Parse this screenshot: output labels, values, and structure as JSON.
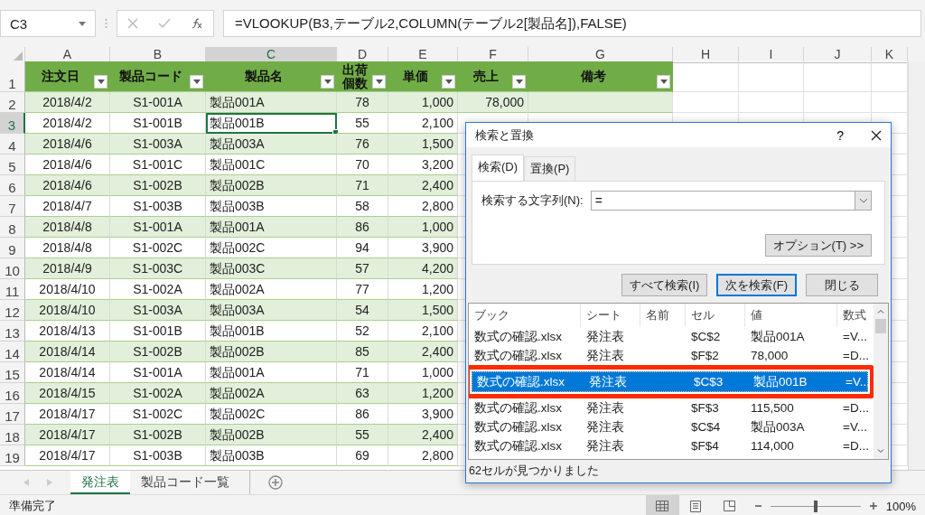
{
  "name_box": "C3",
  "formula": "=VLOOKUP(B3,テーブル2,COLUMN(テーブル2[製品名]),FALSE)",
  "columns": [
    {
      "label": "A",
      "selected": false
    },
    {
      "label": "B",
      "selected": false
    },
    {
      "label": "C",
      "selected": true
    },
    {
      "label": "D",
      "selected": false
    },
    {
      "label": "E",
      "selected": false
    },
    {
      "label": "F",
      "selected": false
    },
    {
      "label": "G",
      "selected": false
    },
    {
      "label": "H",
      "selected": false
    },
    {
      "label": "I",
      "selected": false
    },
    {
      "label": "J",
      "selected": false
    },
    {
      "label": "K",
      "selected": false
    }
  ],
  "header_row": {
    "number": "1",
    "cells": [
      "注文日",
      "製品コード",
      "製品名",
      "出荷個数",
      "単価",
      "売上",
      "備考"
    ]
  },
  "rows": [
    {
      "number": "2",
      "selected": false,
      "cells": [
        "2018/4/2",
        "S1-001A",
        "製品001A",
        "78",
        "1,000",
        "78,000"
      ]
    },
    {
      "number": "3",
      "selected": true,
      "cells": [
        "2018/4/2",
        "S1-001B",
        "製品001B",
        "55",
        "2,100"
      ]
    },
    {
      "number": "4",
      "selected": false,
      "cells": [
        "2018/4/6",
        "S1-003A",
        "製品003A",
        "76",
        "1,500"
      ]
    },
    {
      "number": "5",
      "selected": false,
      "cells": [
        "2018/4/6",
        "S1-001C",
        "製品001C",
        "70",
        "3,200"
      ]
    },
    {
      "number": "6",
      "selected": false,
      "cells": [
        "2018/4/6",
        "S1-002B",
        "製品002B",
        "71",
        "2,400"
      ]
    },
    {
      "number": "7",
      "selected": false,
      "cells": [
        "2018/4/7",
        "S1-003B",
        "製品003B",
        "58",
        "2,800"
      ]
    },
    {
      "number": "8",
      "selected": false,
      "cells": [
        "2018/4/8",
        "S1-001A",
        "製品001A",
        "86",
        "1,000"
      ]
    },
    {
      "number": "9",
      "selected": false,
      "cells": [
        "2018/4/8",
        "S1-002C",
        "製品002C",
        "94",
        "3,900"
      ]
    },
    {
      "number": "10",
      "selected": false,
      "cells": [
        "2018/4/9",
        "S1-003C",
        "製品003C",
        "57",
        "4,200"
      ]
    },
    {
      "number": "11",
      "selected": false,
      "cells": [
        "2018/4/10",
        "S1-002A",
        "製品002A",
        "77",
        "1,200"
      ]
    },
    {
      "number": "12",
      "selected": false,
      "cells": [
        "2018/4/10",
        "S1-003A",
        "製品003A",
        "54",
        "1,500"
      ]
    },
    {
      "number": "13",
      "selected": false,
      "cells": [
        "2018/4/13",
        "S1-001B",
        "製品001B",
        "52",
        "2,100"
      ]
    },
    {
      "number": "14",
      "selected": false,
      "cells": [
        "2018/4/14",
        "S1-002B",
        "製品002B",
        "85",
        "2,400"
      ]
    },
    {
      "number": "15",
      "selected": false,
      "cells": [
        "2018/4/14",
        "S1-001A",
        "製品001A",
        "71",
        "1,000"
      ]
    },
    {
      "number": "16",
      "selected": false,
      "cells": [
        "2018/4/15",
        "S1-002A",
        "製品002A",
        "63",
        "1,200"
      ]
    },
    {
      "number": "17",
      "selected": false,
      "cells": [
        "2018/4/17",
        "S1-002C",
        "製品002C",
        "86",
        "3,900"
      ]
    },
    {
      "number": "18",
      "selected": false,
      "cells": [
        "2018/4/17",
        "S1-002B",
        "製品002B",
        "55",
        "2,400"
      ]
    },
    {
      "number": "19",
      "selected": false,
      "cells": [
        "2018/4/17",
        "S1-003B",
        "製品003B",
        "69",
        "2,800"
      ]
    }
  ],
  "sheet_tabs": [
    {
      "label": "発注表",
      "selected": true
    },
    {
      "label": "製品コード一覧",
      "selected": false
    }
  ],
  "status_bar": {
    "text": "準備完了",
    "views": [
      {
        "selected": true
      },
      {
        "selected": false
      },
      {
        "selected": false
      }
    ],
    "zoom": {
      "level": 0.5,
      "reading": "100%"
    }
  },
  "dialog": {
    "title": "検索と置換",
    "help": "?",
    "tabs": [
      {
        "label": "検索(D)",
        "selected": true
      },
      {
        "label": "置換(P)",
        "selected": false
      }
    ],
    "find_label": "検索する文字列(N):",
    "find_value": "=",
    "options_button": "オプション(T) >>",
    "buttons": [
      {
        "label": "すべて検索(I)",
        "default": false
      },
      {
        "label": "次を検索(F)",
        "default": true
      },
      {
        "label": "閉じる",
        "default": false
      }
    ],
    "results": {
      "columns": [
        "ブック",
        "シート",
        "名前",
        "セル",
        "値",
        "数式"
      ],
      "rows": [
        {
          "cells": [
            "数式の確認.xlsx",
            "発注表",
            "",
            "$C$2",
            "製品001A",
            "=V..."
          ],
          "selected": false
        },
        {
          "cells": [
            "数式の確認.xlsx",
            "発注表",
            "",
            "$F$2",
            "78,000",
            "=D..."
          ],
          "selected": false
        },
        {
          "cells": [
            "数式の確認.xlsx",
            "発注表",
            "",
            "$C$3",
            "製品001B",
            "=V..."
          ],
          "selected": true
        },
        {
          "cells": [
            "数式の確認.xlsx",
            "発注表",
            "",
            "$F$3",
            "115,500",
            "=D..."
          ],
          "selected": false
        },
        {
          "cells": [
            "数式の確認.xlsx",
            "発注表",
            "",
            "$C$4",
            "製品003A",
            "=V..."
          ],
          "selected": false
        },
        {
          "cells": [
            "数式の確認.xlsx",
            "発注表",
            "",
            "$F$4",
            "114,000",
            "=D..."
          ],
          "selected": false
        }
      ]
    },
    "status": "62セルが見つかりました"
  }
}
